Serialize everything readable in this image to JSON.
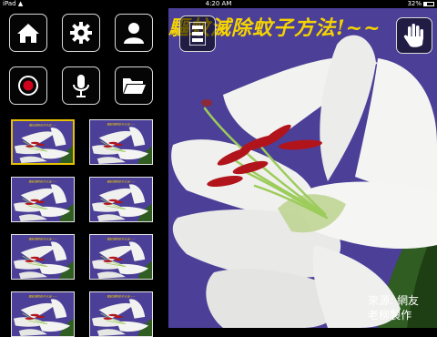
{
  "status_bar": {
    "device": "iPad",
    "wifi_icon": "wifi-icon",
    "time": "4:20 AM",
    "battery_percent": "32%",
    "battery_level": 0.32
  },
  "toolbar": {
    "home_icon": "home-icon",
    "settings_icon": "gear-icon",
    "profile_icon": "person-icon",
    "record_icon": "record-icon",
    "mic_icon": "microphone-icon",
    "folder_icon": "folder-icon"
  },
  "slides": {
    "selected_index": 0,
    "count_visible": 8,
    "thumb_caption": "驅蚊滅除蚊子方法!~~"
  },
  "main": {
    "title": "驅蚊滅除蚊子方法!~~",
    "credit_line1": "來源: 網友",
    "credit_line2": "老柳製作",
    "menu_icon": "list-icon",
    "hand_icon": "hand-icon"
  },
  "colors": {
    "title_yellow": "#f5d300",
    "selection_border": "#e5c100",
    "background_purple": "#4b3f98",
    "record_red": "#d0021b"
  }
}
